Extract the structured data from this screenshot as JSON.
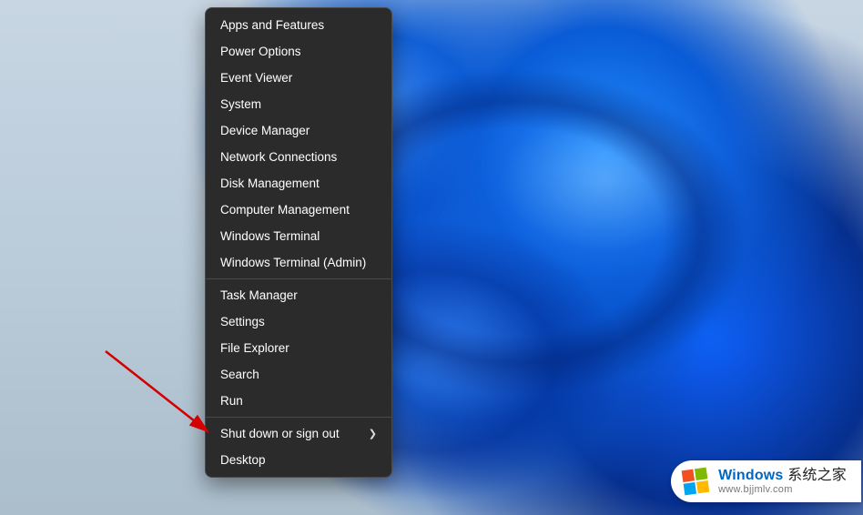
{
  "menu": {
    "groups": [
      [
        {
          "id": "apps-and-features",
          "label": "Apps and Features"
        },
        {
          "id": "power-options",
          "label": "Power Options"
        },
        {
          "id": "event-viewer",
          "label": "Event Viewer"
        },
        {
          "id": "system",
          "label": "System"
        },
        {
          "id": "device-manager",
          "label": "Device Manager"
        },
        {
          "id": "network-connections",
          "label": "Network Connections"
        },
        {
          "id": "disk-management",
          "label": "Disk Management"
        },
        {
          "id": "computer-management",
          "label": "Computer Management"
        },
        {
          "id": "windows-terminal",
          "label": "Windows Terminal"
        },
        {
          "id": "windows-terminal-admin",
          "label": "Windows Terminal (Admin)"
        }
      ],
      [
        {
          "id": "task-manager",
          "label": "Task Manager"
        },
        {
          "id": "settings",
          "label": "Settings"
        },
        {
          "id": "file-explorer",
          "label": "File Explorer"
        },
        {
          "id": "search",
          "label": "Search"
        },
        {
          "id": "run",
          "label": "Run"
        }
      ],
      [
        {
          "id": "shut-down-or-sign-out",
          "label": "Shut down or sign out",
          "submenu": true
        },
        {
          "id": "desktop",
          "label": "Desktop"
        }
      ]
    ]
  },
  "annotation": {
    "target_item_id": "run",
    "arrow_color": "#d40000"
  },
  "watermark": {
    "brand": "Windows",
    "brand_suffix": " 系统之家",
    "url": "www.bjjmlv.com",
    "logo_colors": {
      "tl": "#f25022",
      "tr": "#7fba00",
      "bl": "#00a4ef",
      "br": "#ffb900"
    }
  }
}
